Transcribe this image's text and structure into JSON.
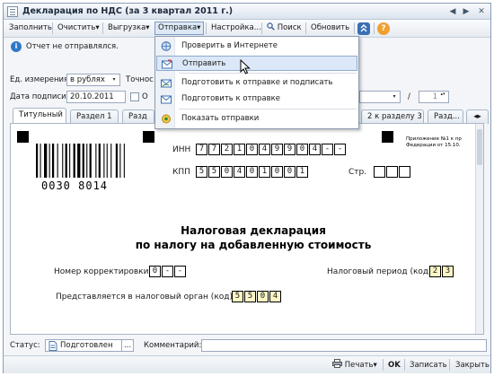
{
  "window": {
    "title": "Декларация по НДС (за 3 квартал 2011 г.)",
    "controls": [
      "◀",
      "▶",
      "✕"
    ]
  },
  "toolbar": {
    "fill_label": "Заполнить",
    "clear_label": "Очистить",
    "export_label": "Выгрузка",
    "send_label": "Отправка",
    "settings_label": "Настройка...",
    "search_label": "Поиск",
    "refresh_label": "Обновить",
    "arrow_char": "▾",
    "help_char": "?"
  },
  "send_menu": {
    "items": [
      {
        "label": "Проверить в Интернете",
        "icon": "globe-check-icon"
      },
      {
        "label": "Отправить",
        "icon": "send-envelope-icon"
      },
      {
        "label": "Подготовить к отправке и подписать",
        "icon": "envelope-sign-icon"
      },
      {
        "label": "Подготовить к отправке",
        "icon": "envelope-icon"
      },
      {
        "label": "Показать отправки",
        "icon": "show-sent-icon"
      }
    ]
  },
  "notice": {
    "icon_char": "i",
    "text": "Отчет не отправлялся."
  },
  "form": {
    "unit_label": "Ед. измерения:",
    "unit_value": "в рублях",
    "accuracy_label": "Точнос",
    "sign_date_label": "Дата подписи:",
    "sign_date_value": "20.10.2011",
    "checkbox_label": "О",
    "num_sep": "/",
    "num_value": "1",
    "dd_char": "▾",
    "spin_char": "▴▾"
  },
  "tabs": [
    "Титульный",
    "Раздел 1",
    "Разд",
    "2 к разделу 3",
    "Разд..."
  ],
  "document": {
    "barcode_number": "0030 8014",
    "inn_label": "ИНН",
    "inn_digits": [
      "7",
      "7",
      "2",
      "1",
      "0",
      "4",
      "9",
      "9",
      "0",
      "4",
      "-",
      "-"
    ],
    "kpp_label": "КПП",
    "kpp_digits": [
      "5",
      "5",
      "0",
      "4",
      "0",
      "1",
      "0",
      "0",
      "1"
    ],
    "page_label": "Стр.",
    "appendix_line1": "Приложение №1 к пр",
    "appendix_line2": "Федерации от 15.10.",
    "title_line1": "Налоговая декларация",
    "title_line2": "по налогу на добавленную стоимость",
    "correction_label": "Номер корректировки",
    "correction_digits": [
      "0",
      "-",
      "-"
    ],
    "period_label": "Налоговый период (код)",
    "period_digits": [
      "2",
      "3"
    ],
    "authority_label": "Представляется в налоговый орган (код)",
    "authority_digits": [
      "5",
      "5",
      "0",
      "4"
    ]
  },
  "bottom": {
    "status_label": "Статус:",
    "status_value": "Подготовлен",
    "status_btn": "...",
    "comment_label": "Комментарий:",
    "comment_value": ""
  },
  "footer": {
    "print_label": "Печать",
    "ok_label": "OK",
    "save_label": "Записать",
    "close_label": "Закрыть"
  },
  "colors": {
    "accent": "#2f78c7",
    "highlight": "#dce8f7",
    "yellow_cell": "#fbf6c4"
  }
}
